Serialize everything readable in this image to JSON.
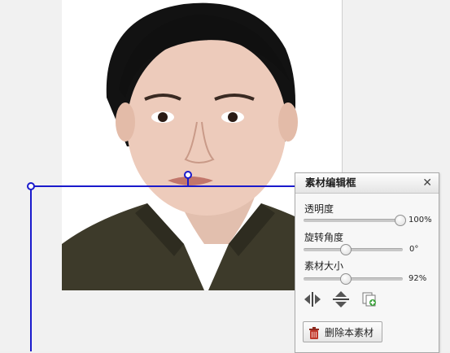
{
  "panel": {
    "title": "素材编辑框",
    "close_glyph": "✕",
    "opacity": {
      "label": "透明度",
      "value_text": "100%",
      "value": 1.0
    },
    "rotation": {
      "label": "旋转角度",
      "value_text": "0°",
      "value": 0.42
    },
    "size": {
      "label": "素材大小",
      "value_text": "92%",
      "value": 0.42
    },
    "tools": [
      "flip-horizontal-icon",
      "flip-vertical-icon",
      "duplicate-icon"
    ],
    "delete_label": "删除本素材"
  },
  "colors": {
    "selection": "#1a1acc",
    "accent_green": "#3aa23a",
    "trash_red": "#c0392b"
  }
}
